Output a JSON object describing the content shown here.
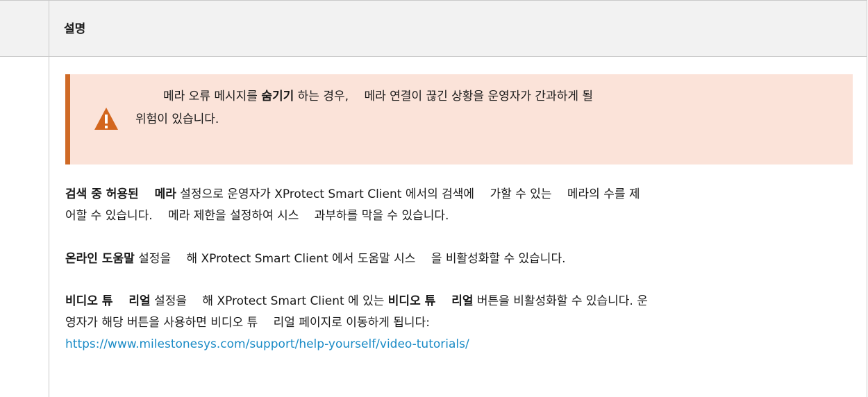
{
  "table": {
    "header": "설명"
  },
  "warning": {
    "icon": "warning-triangle-icon",
    "text_pre": "메라 오류 메시지를 ",
    "text_bold": "숨기기",
    "text_post": " 하는 경우, 　메라 연결이 끊긴 상황을 운영자가 간과하게 될",
    "line2": "위험이 있습니다.",
    "colors": {
      "bar": "#cf6a26",
      "background": "#fbe3d9",
      "icon": "#d3661e"
    }
  },
  "paragraphs": {
    "p1": {
      "bold": "검색 중 허용된 　메라",
      "text": " 설정으로 운영자가 XProtect Smart Client 에서의 검색에 　가할 수 있는 　메라의 수를 제",
      "line2": "어할 수 있습니다. 　메라 제한을 설정하여 시스 　과부하를 막을 수 있습니다."
    },
    "p2": {
      "bold": "온라인 도움말",
      "text": " 설정을 　해 XProtect Smart Client 에서 도움말 시스 　을 비활성화할 수 있습니다."
    },
    "p3": {
      "bold1": "비디오 튜 　리얼",
      "text1": " 설정을 　해 XProtect Smart Client 에 있는 ",
      "bold2": "비디오 튜 　리얼",
      "text2": " 버튼을 비활성화할 수 있습니다. 운",
      "line2": "영자가 해당 버튼을 사용하면 비디오 튜 　리얼 페이지로 이동하게 됩니다:",
      "link": "https://www.milestonesys.com/support/help-yourself/video-tutorials/",
      "link_color": "#1a8bc6"
    }
  }
}
